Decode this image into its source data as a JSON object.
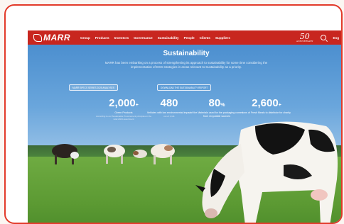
{
  "nav": {
    "brand": "MARR",
    "items": [
      "Group",
      "Products",
      "Investors",
      "Governance",
      "Sustainability",
      "People",
      "Clients",
      "Suppliers"
    ],
    "anniversary_number": "50",
    "anniversary_text": "ANNIVERSARY",
    "language": "Eng"
  },
  "hero": {
    "title": "Sustainability",
    "intro": "MARR has been embarking on a process of strengthening its approach to sustainability for some time considering the implementation of ESG strategies in areas relevant to Sustainability as a priority.",
    "pill_left": "MARR SPECS SERIES 2025 ANALYSES",
    "pill_center": "DOWNLOAD THE SUSTAINABILITY REPORT"
  },
  "stats": [
    {
      "value": "2,000",
      "suffix": "+",
      "label": "Green Products",
      "sub": "According to our Sustainable Procurement principles in the total 2024 assortment"
    },
    {
      "value": "480",
      "suffix": "",
      "label": "Vehicles with low environmental impact",
      "sub": "out of 1,111"
    },
    {
      "value": "80",
      "suffix": "%",
      "label": "of the Materials used for the packaging comes from recyclable sources",
      "sub": ""
    },
    {
      "value": "2,600",
      "suffix": "+",
      "label": "tons of Fresh Meals to distribute for charity",
      "sub": ""
    }
  ]
}
